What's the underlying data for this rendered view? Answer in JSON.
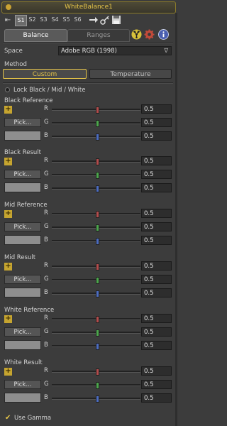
{
  "window": {
    "title": "WhiteBalance1"
  },
  "toolbar": {
    "slots": [
      "S1",
      "S2",
      "S3",
      "S4",
      "S5",
      "S6"
    ],
    "active_slot": "S1",
    "icons": [
      "arrow-right-icon",
      "key-icon",
      "save-icon"
    ]
  },
  "tabs": [
    {
      "label": "Balance",
      "active": true
    },
    {
      "label": "Ranges",
      "active": false
    }
  ],
  "tab_icons": [
    "radiation-icon",
    "settings-icon",
    "info-icon"
  ],
  "space": {
    "label": "Space",
    "value": "Adobe RGB (1998)",
    "arrow": "∇"
  },
  "method": {
    "label": "Method",
    "options": [
      "Custom",
      "Temperature"
    ],
    "selected": "Custom"
  },
  "lock": {
    "label": "Lock Black / Mid / White"
  },
  "sections": [
    {
      "title": "Black Reference",
      "pick_label": "Pick...",
      "channels": [
        {
          "name": "R",
          "value": "0.5",
          "slider": 0.5,
          "color": "#b24c4c"
        },
        {
          "name": "G",
          "value": "0.5",
          "slider": 0.5,
          "color": "#4ca64c"
        },
        {
          "name": "B",
          "value": "0.5",
          "slider": 0.5,
          "color": "#4c6cc0"
        }
      ]
    },
    {
      "title": "Black Result",
      "pick_label": "Pick...",
      "channels": [
        {
          "name": "R",
          "value": "0.5",
          "slider": 0.5,
          "color": "#b24c4c"
        },
        {
          "name": "G",
          "value": "0.5",
          "slider": 0.5,
          "color": "#4ca64c"
        },
        {
          "name": "B",
          "value": "0.5",
          "slider": 0.5,
          "color": "#4c6cc0"
        }
      ]
    },
    {
      "title": "Mid Reference",
      "pick_label": "Pick...",
      "channels": [
        {
          "name": "R",
          "value": "0.5",
          "slider": 0.5,
          "color": "#b24c4c"
        },
        {
          "name": "G",
          "value": "0.5",
          "slider": 0.5,
          "color": "#4ca64c"
        },
        {
          "name": "B",
          "value": "0.5",
          "slider": 0.5,
          "color": "#4c6cc0"
        }
      ]
    },
    {
      "title": "Mid Result",
      "pick_label": "Pick...",
      "channels": [
        {
          "name": "R",
          "value": "0.5",
          "slider": 0.5,
          "color": "#b24c4c"
        },
        {
          "name": "G",
          "value": "0.5",
          "slider": 0.5,
          "color": "#4ca64c"
        },
        {
          "name": "B",
          "value": "0.5",
          "slider": 0.5,
          "color": "#4c6cc0"
        }
      ]
    },
    {
      "title": "White Reference",
      "pick_label": "Pick...",
      "channels": [
        {
          "name": "R",
          "value": "0.5",
          "slider": 0.5,
          "color": "#b24c4c"
        },
        {
          "name": "G",
          "value": "0.5",
          "slider": 0.5,
          "color": "#4ca64c"
        },
        {
          "name": "B",
          "value": "0.5",
          "slider": 0.5,
          "color": "#4c6cc0"
        }
      ]
    },
    {
      "title": "White Result",
      "pick_label": "Pick...",
      "channels": [
        {
          "name": "R",
          "value": "0.5",
          "slider": 0.5,
          "color": "#b24c4c"
        },
        {
          "name": "G",
          "value": "0.5",
          "slider": 0.5,
          "color": "#4ca64c"
        },
        {
          "name": "B",
          "value": "0.5",
          "slider": 0.5,
          "color": "#4c6cc0"
        }
      ]
    }
  ],
  "use_gamma": {
    "label": "Use Gamma",
    "checked": true
  },
  "colors": {
    "accent": "#e6c548",
    "panel_bg": "#3c3c3c"
  }
}
